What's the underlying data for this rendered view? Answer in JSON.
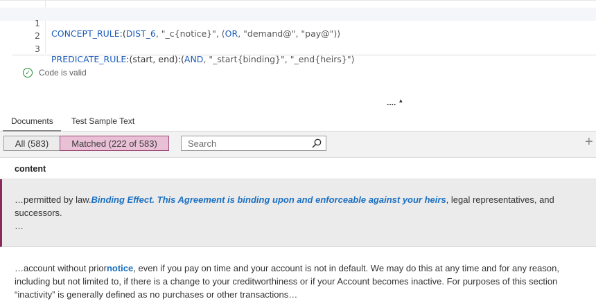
{
  "editor": {
    "lines": [
      {
        "num": "1",
        "kw": "CONCEPT_RULE",
        "p1": ":(",
        "kw2": "DIST_6",
        "p2": ", \"_c{notice}\", (",
        "kw3": "OR",
        "p3": ", \"demand@\", \"pay@\"))"
      },
      {
        "num": "2"
      },
      {
        "num": "3",
        "kw": "PREDICATE_RULE",
        "p1": ":(start, end):(",
        "kw2": "AND",
        "p2": ", \"_start{binding}\", \"_end{heirs}\")"
      }
    ]
  },
  "validation": {
    "text": "Code is valid",
    "color": "#1e8c2e"
  },
  "splitter": {
    "dots": "....",
    "arrow": "▲"
  },
  "tabs": [
    {
      "label": "Documents",
      "active": true
    },
    {
      "label": "Test Sample Text",
      "active": false
    }
  ],
  "filter": {
    "all_label": "All (583)",
    "matched_label": "Matched (222 of 583)",
    "search_placeholder": "Search",
    "add_symbol": "+"
  },
  "results": {
    "column_header": "content",
    "rows": [
      {
        "before": "…permitted by law.",
        "match": "Binding Effect. This Agreement is binding upon and enforceable against your heirs",
        "after": ", legal representatives, and successors.",
        "tail": "…"
      },
      {
        "before": "…account without prior",
        "match": "notice",
        "after": ", even if you pay on time and your account is not in default. We may do this at any time and for any reason, including but not limited to, if there is a change to your creditworthiness or if your Account becomes inactive. For purposes of this section “inactivity” is generally defined as no purchases or other transactions…"
      }
    ]
  },
  "colors": {
    "matched_bg": "#e9c0d6",
    "matched_border": "#9c4a76",
    "row_accent": "#8b2a5a",
    "highlight": "#1a6fc0",
    "keyword": "#1a5bb8"
  }
}
